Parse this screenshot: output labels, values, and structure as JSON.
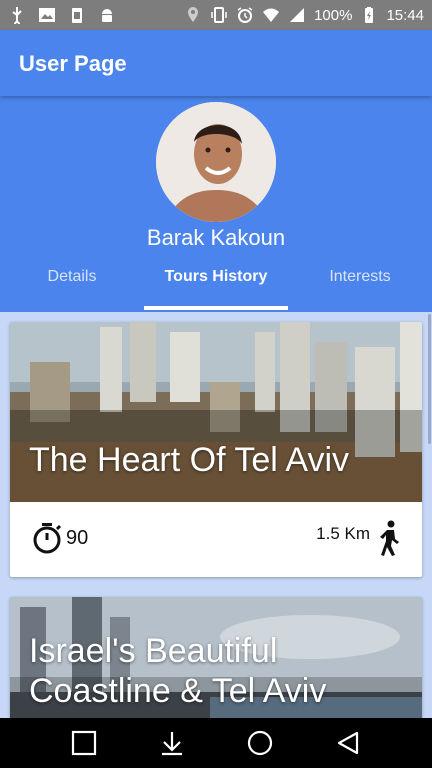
{
  "status_bar": {
    "battery": "100%",
    "time": "15:44",
    "left_icons": [
      "usb-icon",
      "image-icon",
      "battery-saver-icon",
      "android-icon"
    ],
    "right_icons": [
      "location-icon",
      "vibrate-icon",
      "alarm-icon",
      "wifi-icon",
      "signal-icon",
      "battery-icon"
    ]
  },
  "app_bar": {
    "title": "User Page"
  },
  "profile": {
    "name": "Barak Kakoun"
  },
  "tabs": [
    {
      "label": "Details",
      "active": false
    },
    {
      "label": "Tours History",
      "active": true
    },
    {
      "label": "Interests",
      "active": false
    }
  ],
  "tours": [
    {
      "title": "The Heart Of Tel Aviv",
      "duration": "90",
      "distance": "1.5 Km"
    },
    {
      "title_line1": "Israel's Beautiful",
      "title_line2": "Coastline & Tel Aviv"
    }
  ],
  "nav_bar": {
    "buttons": [
      "recent-apps-icon",
      "hide-keyboard-icon",
      "home-icon",
      "back-icon"
    ]
  },
  "colors": {
    "primary": "#4a84ec",
    "status_bar": "#7d7d7d",
    "content_bg": "#c6d7f7"
  }
}
